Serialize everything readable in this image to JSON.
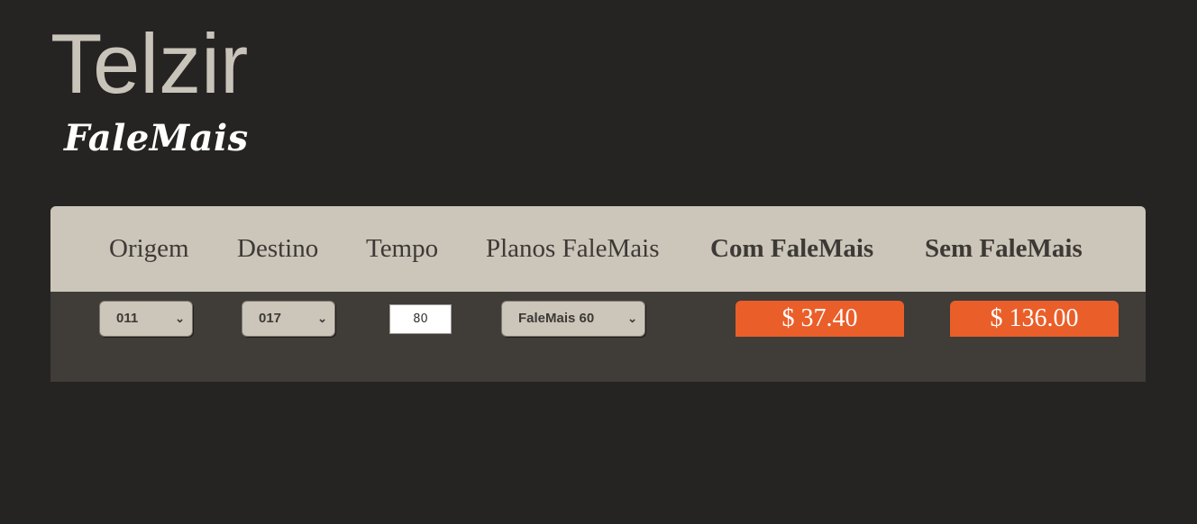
{
  "brand": {
    "title": "Telzir",
    "subtitle": "FaleMais"
  },
  "table": {
    "headers": {
      "origem": "Origem",
      "destino": "Destino",
      "tempo": "Tempo",
      "planos": "Planos FaleMais",
      "com": "Com FaleMais",
      "sem": "Sem FaleMais"
    },
    "row": {
      "origem_value": "011",
      "destino_value": "017",
      "tempo_value": "80",
      "plano_value": "FaleMais 60",
      "com_price": "$ 37.40",
      "sem_price": "$ 136.00"
    }
  },
  "colors": {
    "background": "#252423",
    "header_bg": "#cbc5ba",
    "row_bg": "#403c38",
    "accent": "#ea5e29"
  },
  "icons": {
    "select_arrow": "chevron-down-icon"
  }
}
